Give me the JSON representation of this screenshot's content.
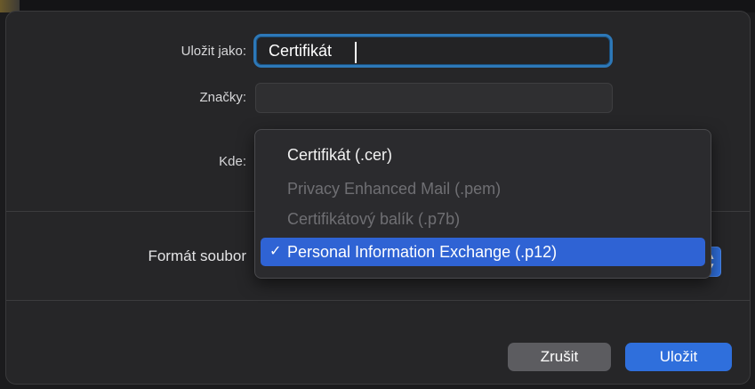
{
  "form": {
    "save_as_label": "Uložit jako:",
    "save_as_value": "Certifikát",
    "tags_label": "Značky:",
    "tags_value": "",
    "where_label": "Kde:",
    "format_label": "Formát soubor"
  },
  "format_menu": {
    "items": [
      {
        "label": "Certifikát (.cer)",
        "state": "enabled"
      },
      {
        "label": "Privacy Enhanced Mail (.pem)",
        "state": "disabled"
      },
      {
        "label": "Certifikátový balík (.p7b)",
        "state": "disabled"
      },
      {
        "label": "Personal Information Exchange (.p12)",
        "state": "selected"
      }
    ],
    "check_glyph": "✓"
  },
  "buttons": {
    "cancel_label": "Zrušit",
    "save_label": "Uložit"
  },
  "colors": {
    "accent": "#2f6fdc",
    "focus_ring": "#2d78b8",
    "dialog_bg": "#262628"
  }
}
